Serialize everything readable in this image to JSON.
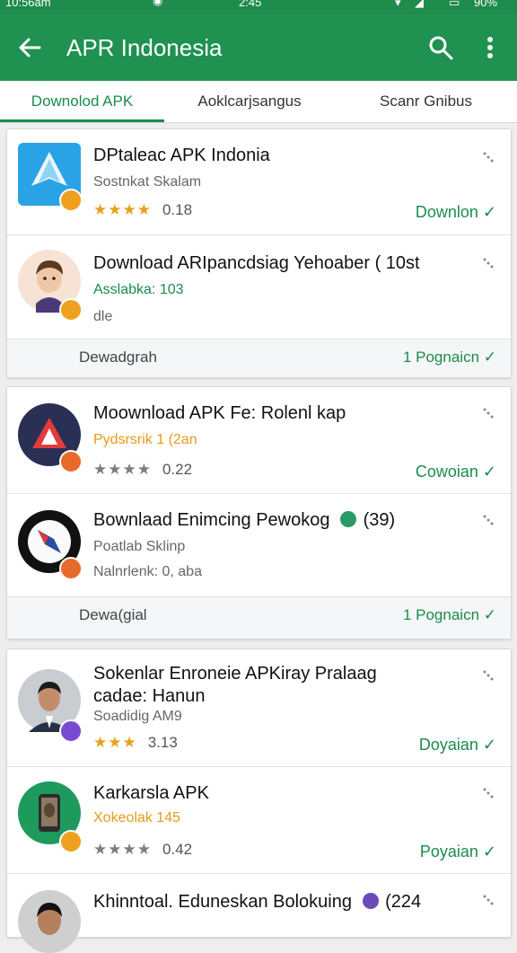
{
  "statusbar": {
    "left": "10:56am",
    "time": "2:45",
    "right": "90%"
  },
  "appbar": {
    "title": "APR Indonesia"
  },
  "tabs": [
    {
      "label": "Downolod APK"
    },
    {
      "label": "Aoklcarjsangus"
    },
    {
      "label": "Scanr Gnibus"
    }
  ],
  "cards": [
    {
      "items": [
        {
          "name": "DPtaleac APK Indonia",
          "sub": "Sostnkat Skalam",
          "stars": "★★★★",
          "rating": "0.18",
          "action": "Downlon ✓"
        },
        {
          "name": "Download ARIpancdsiag Yehoaber ( 10st",
          "sub": "Asslabka: 103",
          "sub2": "dle"
        }
      ],
      "footer": {
        "left": "Dewadgrah",
        "right": "1 Pognaicn ✓"
      }
    },
    {
      "items": [
        {
          "name": "Moownload APK Fe: Rolenl kap",
          "sub": "Pydsrsrik 1 (2an",
          "stars": "★★★★",
          "rating": "0.22",
          "action": "Cowoian ✓"
        },
        {
          "name": "Bownlaad Enimcing Pewokog",
          "name_tail": "(39)",
          "sub": "Poatlab Sklinp",
          "sub2": "Nalnrlenk: 0, aba"
        }
      ],
      "footer": {
        "left": "Dewa(gial",
        "right": "1 Pognaicn ✓"
      }
    },
    {
      "items": [
        {
          "name": "Sokenlar Enroneie APKiray Pralaag",
          "name2": "cadae: Hanun",
          "sub": "Soadidig AM9",
          "stars": "★★★",
          "rating": "3.13",
          "action": "Doyaian ✓"
        },
        {
          "name": "Karkarsla APK",
          "sub": "Xokeolak 145",
          "stars": "★★★★",
          "rating": "0.42",
          "action": "Poyaian ✓"
        },
        {
          "name": "Khinntoal. Eduneskan Bolokuing",
          "name_tail": "(224"
        }
      ]
    }
  ]
}
